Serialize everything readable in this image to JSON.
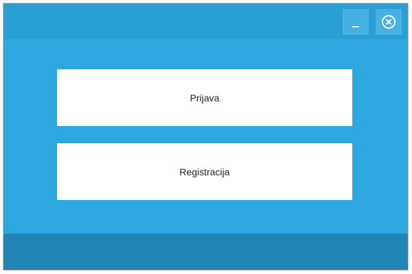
{
  "window": {
    "colors": {
      "background": "#2ea7de",
      "titlebar": "#2a9fd6",
      "titlebar_buttons": "#47b2e2",
      "footer": "#2384b6",
      "button_background": "#ffffff",
      "button_text": "#222222"
    }
  },
  "titlebar": {
    "minimize_icon": "minimize-icon",
    "close_icon": "close-circle-icon"
  },
  "main": {
    "login_label": "Prijava",
    "register_label": "Registracija"
  }
}
